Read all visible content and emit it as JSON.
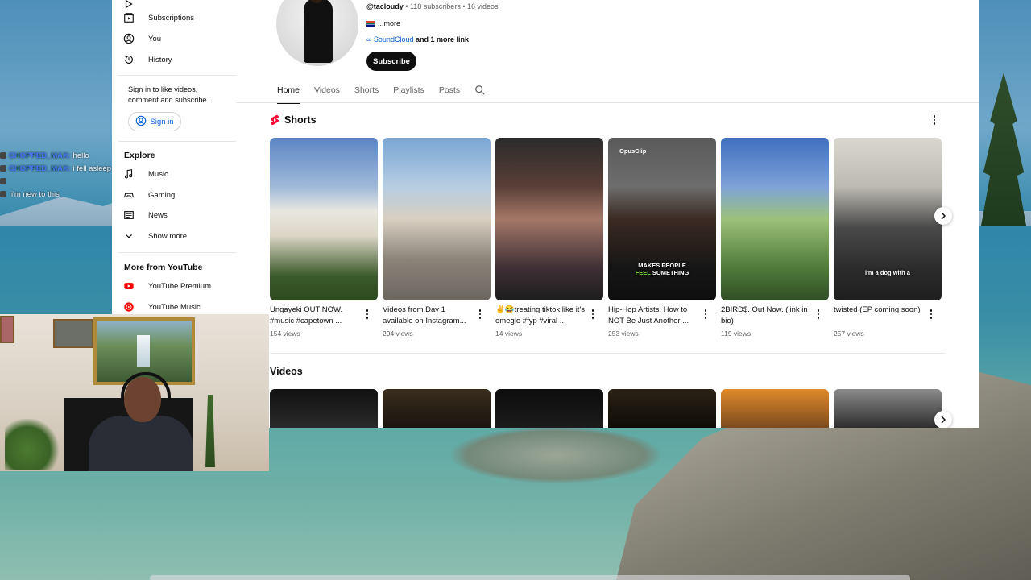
{
  "chat": [
    {
      "user": "CHOPPED_MAX:",
      "message": "hello",
      "green": false
    },
    {
      "user": "CHOPPED_MAX:",
      "message": "i fell asleep w",
      "green": false
    },
    {
      "user": "",
      "message": "",
      "green": true
    },
    {
      "user": "",
      "message": "i'm new to this",
      "green": true
    }
  ],
  "sidebar": {
    "items": [
      {
        "label": "Subscriptions",
        "icon": "subscriptions-icon"
      },
      {
        "label": "You",
        "icon": "account-icon"
      },
      {
        "label": "History",
        "icon": "history-icon"
      }
    ],
    "signin_text": "Sign in to like videos, comment and subscribe.",
    "signin_label": "Sign in",
    "explore_heading": "Explore",
    "explore": [
      {
        "label": "Music",
        "icon": "music-icon"
      },
      {
        "label": "Gaming",
        "icon": "gaming-icon"
      },
      {
        "label": "News",
        "icon": "news-icon"
      },
      {
        "label": "Show more",
        "icon": "chevron-down-icon"
      }
    ],
    "more_heading": "More from YouTube",
    "more": [
      {
        "label": "YouTube Premium",
        "icon": "youtube-premium-icon"
      },
      {
        "label": "YouTube Music",
        "icon": "youtube-music-icon"
      }
    ]
  },
  "channel": {
    "handle": "@tacloudy",
    "stats": " • 118 subscribers • 16 videos",
    "more": "...more",
    "link_name": "SoundCloud",
    "link_more": " and 1 more link",
    "subscribe_label": "Subscribe"
  },
  "tabs": [
    "Home",
    "Videos",
    "Shorts",
    "Playlists",
    "Posts"
  ],
  "shorts_heading": "Shorts",
  "videos_heading": "Videos",
  "shorts": [
    {
      "title": "Ungayeki OUT NOW. #music #capetown ...",
      "views": "154 views",
      "caption": "",
      "bg": "linear-gradient(180deg,#5b86c4 0%,#9fb9d9 30%,#e8e6df 45%,#dcd6c7 60%,#3b5a2a 85%,#2d4a1f 100%)"
    },
    {
      "title": "Videos from Day 1 available on Instagram...",
      "views": "294 views",
      "caption": "",
      "bg": "linear-gradient(180deg,#7aa6d4 0%,#b6cde2 30%,#d8cfc1 50%,#8a8378 75%,#6b6660 100%)"
    },
    {
      "title": "✌️😂treating tiktok like it's omegle #fyp #viral ...",
      "views": "14 views",
      "caption": "",
      "bg": "linear-gradient(180deg,#2b2b2b 0%,#5a3f38 30%,#a57868 50%,#3f3036 80%,#1d1d1d 100%)"
    },
    {
      "title": "Hip-Hop Artists: How to NOT Be Just Another ...",
      "views": "253 views",
      "caption": "MAKES PEOPLE",
      "caption2": "FEEL",
      "caption3": "SOMETHING",
      "opus": "OpusClip",
      "bg": "linear-gradient(180deg,#5a5a5a 0%,#6d6d6d 30%,#3b2a22 50%,#161616 80%,#0e0e0e 100%)"
    },
    {
      "title": "2BIRD$. Out Now. (link in bio)",
      "views": "119 views",
      "caption": "",
      "bg": "linear-gradient(180deg,#3f6fbf 0%,#7ea2d8 30%,#9bc17a 50%,#4f7a3a 80%,#2f4f24 100%)"
    },
    {
      "title": "twisted (EP coming soon)",
      "views": "257 views",
      "caption": "i'm a dog with a",
      "bg": "linear-gradient(180deg,#d9d7d0 0%,#bdbab2 30%,#4a4a4a 55%,#2c2c2c 80%,#1e1e1e 100%)"
    }
  ],
  "videos": [
    {
      "bg": "linear-gradient(180deg,#111,#2a2a2a)"
    },
    {
      "bg": "linear-gradient(180deg,#3a2d1c,#1a1510)"
    },
    {
      "bg": "linear-gradient(180deg,#0d0d0d,#1b1b1b)"
    },
    {
      "bg": "linear-gradient(180deg,#2a2214,#0f0c08)"
    },
    {
      "bg": "linear-gradient(180deg,#e08a2a,#7a4b1f)"
    },
    {
      "bg": "linear-gradient(180deg,#8a8a8a,#2e2e2e)"
    }
  ]
}
